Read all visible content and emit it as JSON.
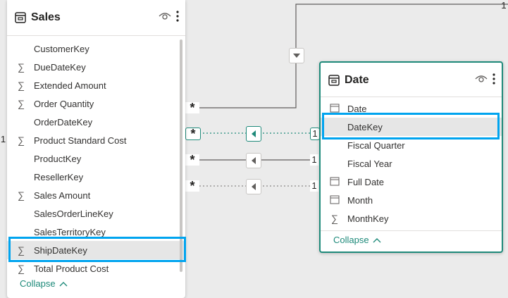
{
  "sales": {
    "title": "Sales",
    "fields": [
      {
        "label": "CustomerKey",
        "icon": ""
      },
      {
        "label": "DueDateKey",
        "icon": "sigma-icon"
      },
      {
        "label": "Extended Amount",
        "icon": "sigma-icon"
      },
      {
        "label": "Order Quantity",
        "icon": "sigma-icon"
      },
      {
        "label": "OrderDateKey",
        "icon": ""
      },
      {
        "label": "Product Standard Cost",
        "icon": "sigma-icon"
      },
      {
        "label": "ProductKey",
        "icon": ""
      },
      {
        "label": "ResellerKey",
        "icon": ""
      },
      {
        "label": "Sales Amount",
        "icon": "sigma-icon"
      },
      {
        "label": "SalesOrderLineKey",
        "icon": ""
      },
      {
        "label": "SalesTerritoryKey",
        "icon": ""
      },
      {
        "label": "ShipDateKey",
        "icon": "sigma-icon"
      },
      {
        "label": "Total Product Cost",
        "icon": "sigma-icon"
      }
    ],
    "collapse_label": "Collapse",
    "selected_field": "ShipDateKey"
  },
  "date": {
    "title": "Date",
    "fields": [
      {
        "label": "Date",
        "icon": "calendar-icon"
      },
      {
        "label": "DateKey",
        "icon": ""
      },
      {
        "label": "Fiscal Quarter",
        "icon": ""
      },
      {
        "label": "Fiscal Year",
        "icon": ""
      },
      {
        "label": "Full Date",
        "icon": "calendar-icon"
      },
      {
        "label": "Month",
        "icon": "calendar-icon"
      },
      {
        "label": "MonthKey",
        "icon": "sigma-icon"
      }
    ],
    "collapse_label": "Collapse",
    "selected_field": "DateKey"
  },
  "relationships": {
    "many_symbol": "*",
    "one_symbol": "1"
  },
  "colors": {
    "highlight": "#00a4ef",
    "active_border": "#1e8a7a",
    "line": "#605e5c"
  }
}
